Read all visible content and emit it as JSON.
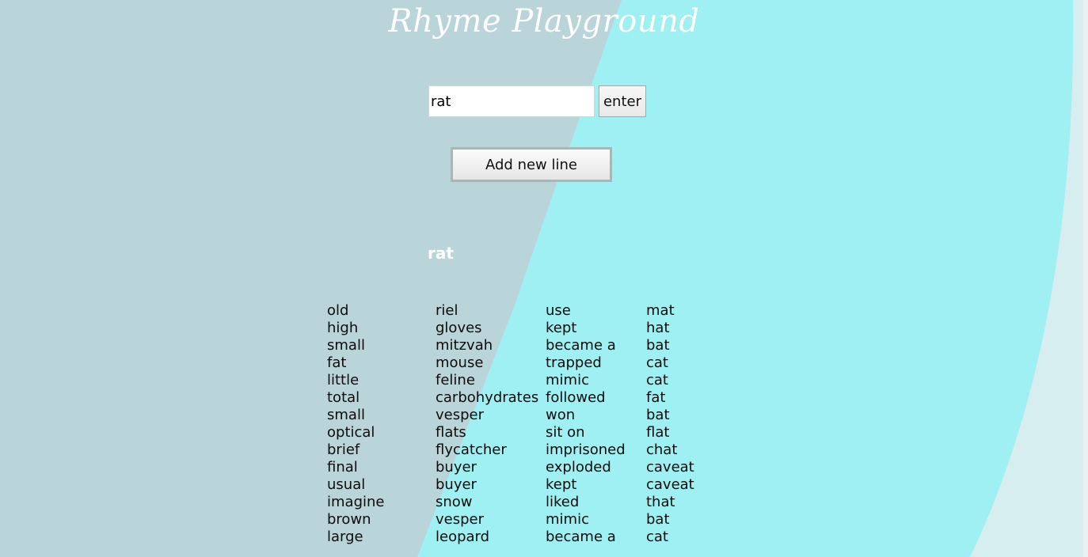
{
  "app": {
    "title": "Rhyme Playground"
  },
  "search": {
    "value": "rat",
    "enter_label": "enter"
  },
  "actions": {
    "add_line_label": "Add new line"
  },
  "current_word": "rat",
  "word_columns": [
    [
      "old",
      "high",
      "small",
      "fat",
      "little",
      "total",
      "small",
      "optical",
      "brief",
      "final",
      "usual",
      "imagine",
      "brown",
      "large"
    ],
    [
      "riel",
      "gloves",
      "mitzvah",
      "mouse",
      "feline",
      "carbohydrates",
      "vesper",
      "flats",
      "flycatcher",
      "buyer",
      "buyer",
      "snow",
      "vesper",
      "leopard"
    ],
    [
      "use",
      "kept",
      "became a",
      "trapped",
      "mimic",
      "followed",
      "won",
      "sit on",
      "imprisoned",
      "exploded",
      "kept",
      "liked",
      "mimic",
      "became a"
    ],
    [
      "mat",
      "hat",
      "bat",
      "cat",
      "cat",
      "fat",
      "bat",
      "flat",
      "chat",
      "caveat",
      "caveat",
      "that",
      "bat",
      "cat"
    ]
  ],
  "colors": {
    "background_gray": "#b9d5d9",
    "accent_cyan": "#9ef0f2",
    "outer_pale": "#d7eef1",
    "title_text": "#ffffff"
  }
}
